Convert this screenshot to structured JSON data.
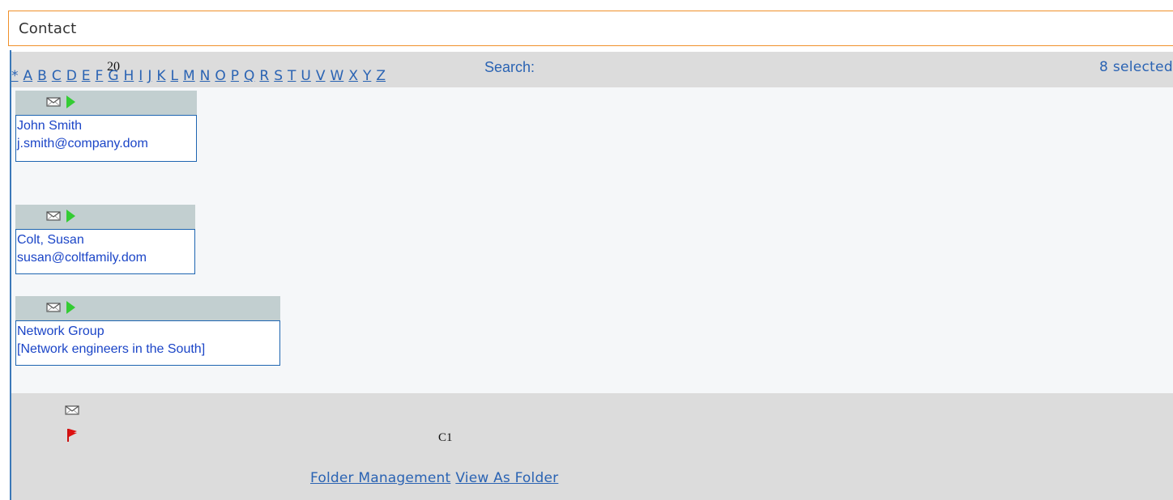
{
  "header": {
    "title": "Contact"
  },
  "toolbar": {
    "page_size": "20",
    "search_label": "Search:",
    "selected_count": "8 selected"
  },
  "alphabet": [
    "*",
    "A",
    "B",
    "C",
    "D",
    "E",
    "F",
    "G",
    "H",
    "I",
    "J",
    "K",
    "L",
    "M",
    "N",
    "O",
    "P",
    "Q",
    "R",
    "S",
    "T",
    "U",
    "V",
    "W",
    "X",
    "Y",
    "Z"
  ],
  "contacts": [
    {
      "line1": "John Smith",
      "line2": "j.smith@company.dom",
      "icons": [
        "envelope-icon",
        "play-icon"
      ]
    },
    {
      "line1": "Colt, Susan",
      "line2": "susan@coltfamily.dom",
      "icons": [
        "envelope-icon",
        "play-icon"
      ]
    },
    {
      "line1": "Network Group",
      "line2": "[Network engineers in the South]",
      "icons": [
        "envelope-icon",
        "play-icon"
      ]
    }
  ],
  "footer": {
    "label": "C1",
    "links": [
      "Folder Management",
      "View As Folder"
    ],
    "icons": [
      "envelope-icon",
      "flag-icon"
    ]
  },
  "colors": {
    "accent_link": "#2a63b3",
    "header_border": "#f0902a",
    "panel_gray": "#dcdcdc",
    "card_head": "#c2cfd0",
    "card_border": "#1e65b1",
    "play_green": "#33cc33",
    "flag_red": "#dd1111"
  }
}
